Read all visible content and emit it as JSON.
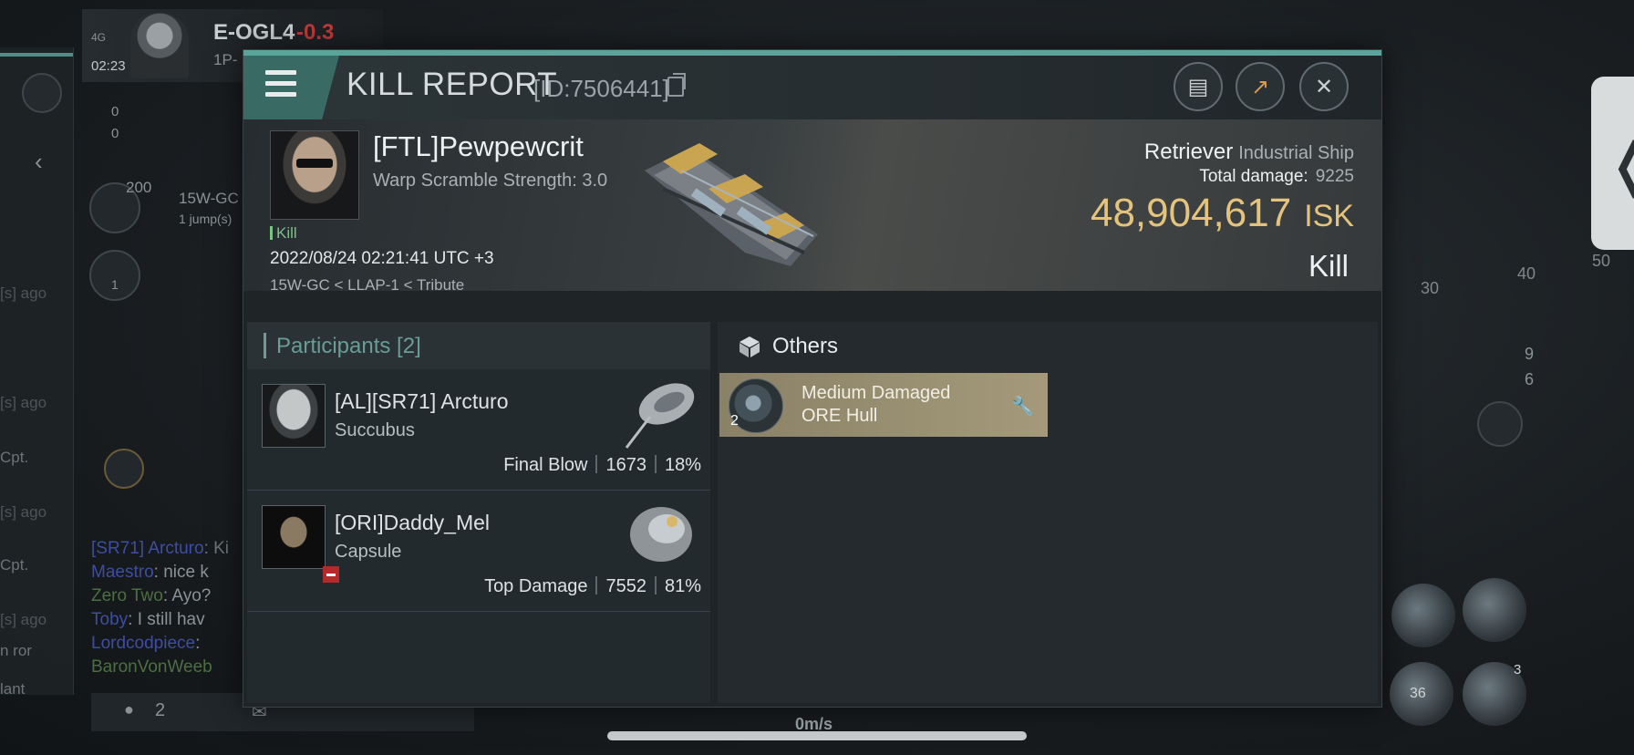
{
  "background": {
    "system_name": "E-OGL4",
    "system_security": "-0.3",
    "clock": "02:23",
    "net": "4G",
    "sub_text": "1P-",
    "route_text": "15W-GC",
    "route_sub": "1 jump(s)",
    "count_200": "200",
    "count_one": "1",
    "flag_blue_count": "0",
    "flag_red_count": "0",
    "left_labels": [
      "[s] ago",
      "[s] ago",
      "Cpt.",
      "[s] ago",
      "Cpt.",
      "[s] ago",
      "n ror",
      "lant"
    ],
    "chat": [
      {
        "name": "[SR71] Arcturo",
        "text": ": Ki"
      },
      {
        "name": "Maestro",
        "text": ": nice k"
      },
      {
        "name": "Zero Two",
        "text": ": Ayo?"
      },
      {
        "name": "Toby",
        "text": ": I still hav"
      },
      {
        "name": "Lordcodpiece",
        "text": ":"
      },
      {
        "name": "BaronVonWeeb",
        "text": ""
      }
    ],
    "bottom_count": "2",
    "speed": "0m/s",
    "ticks": [
      "30",
      "40",
      "50"
    ],
    "overview_counts": [
      "9",
      "6"
    ],
    "module_counts": [
      "36",
      "3"
    ]
  },
  "report": {
    "title": "KILL REPORT",
    "id_text": "[ID:7506441]",
    "victim": {
      "name": "[FTL]Pewpewcrit",
      "sub": "Warp Scramble Strength: 3.0",
      "tag": "Kill",
      "date": "2022/08/24 02:21:41 UTC +3",
      "location": "15W-GC < LLAP-1 < Tribute",
      "ship": "Retriever",
      "ship_class": "Industrial Ship",
      "total_damage_label": "Total damage:",
      "total_damage": "9225",
      "isk_value": "48,904,617",
      "isk_unit": "ISK",
      "result": "Kill"
    },
    "participants": {
      "header": "Participants [2]",
      "rows": [
        {
          "name": "[AL][SR71] Arcturo",
          "ship": "Succubus",
          "role": "Final Blow",
          "damage": "1673",
          "percent": "18%"
        },
        {
          "name": "[ORI]Daddy_Mel",
          "ship": "Capsule",
          "role": "Top Damage",
          "damage": "7552",
          "percent": "81%"
        }
      ]
    },
    "others": {
      "header": "Others",
      "items": [
        {
          "qty": "2",
          "line1": "Medium Damaged",
          "line2": "ORE Hull"
        }
      ]
    }
  },
  "colors": {
    "accent_teal": "#5aa59b",
    "isk_gold": "#e3c37d",
    "item_card": "#a49a7a"
  }
}
